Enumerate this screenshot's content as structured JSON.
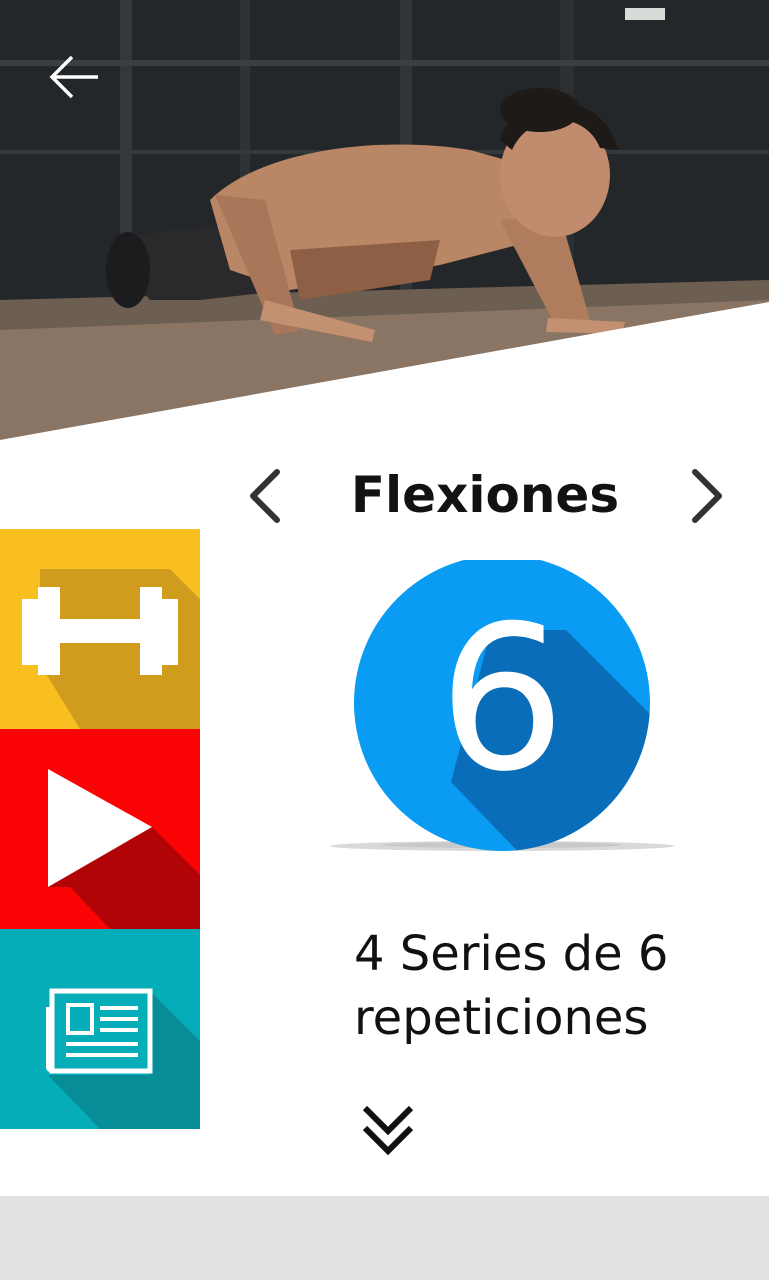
{
  "exercise": {
    "title": "Flexiones",
    "number": "6",
    "description_line1": "4 Series de 6",
    "description_line2": "repeticiones"
  },
  "icons": {
    "back": "arrow-left-icon",
    "prev": "chevron-left-icon",
    "next": "chevron-right-icon",
    "workout": "dumbbell-icon",
    "video": "play-icon",
    "news": "newspaper-icon",
    "more": "double-chevron-down-icon"
  },
  "colors": {
    "workout_tile": "#f9be1f",
    "video_tile": "#fb0406",
    "news_tile": "#05adb9",
    "badge": "#0a9cf2",
    "badge_shadow": "#0a6dba"
  }
}
